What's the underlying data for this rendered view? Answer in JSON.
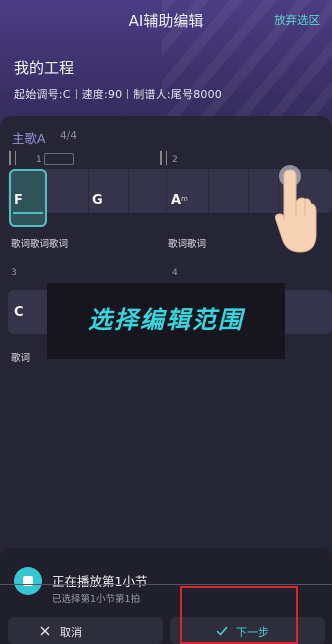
{
  "header": {
    "title": "AI辅助编辑",
    "abandon_label": "放弃选区"
  },
  "project": {
    "name": "我的工程",
    "key": "起始调号:C",
    "tempo": "速度:90",
    "author": "制谱人:尾号8000"
  },
  "section": {
    "name": "主歌A",
    "count": "4/4"
  },
  "bars": [
    {
      "num": "1",
      "chords": [
        "F",
        "G"
      ],
      "lyric": "歌词歌词歌词"
    },
    {
      "num": "2",
      "chords": [
        "A",
        "m"
      ],
      "lyric": "歌词歌词"
    },
    {
      "num": "3",
      "chords": [
        "C"
      ],
      "lyric": "歌词"
    },
    {
      "num": "4",
      "chords": [],
      "lyric": ""
    }
  ],
  "overlay_text": "选择编辑范围",
  "bottom": {
    "playing": "正在播放第1小节",
    "selected": "已选择第1小节第1拍",
    "cancel_label": "取消",
    "next_label": "下一步"
  },
  "colors": {
    "accent": "#35c7cf",
    "highlight_box": "#e0232a",
    "section": "#9a93d9"
  },
  "icons": [
    "close-icon",
    "check-icon",
    "stop-icon",
    "hand-pointer-icon"
  ]
}
